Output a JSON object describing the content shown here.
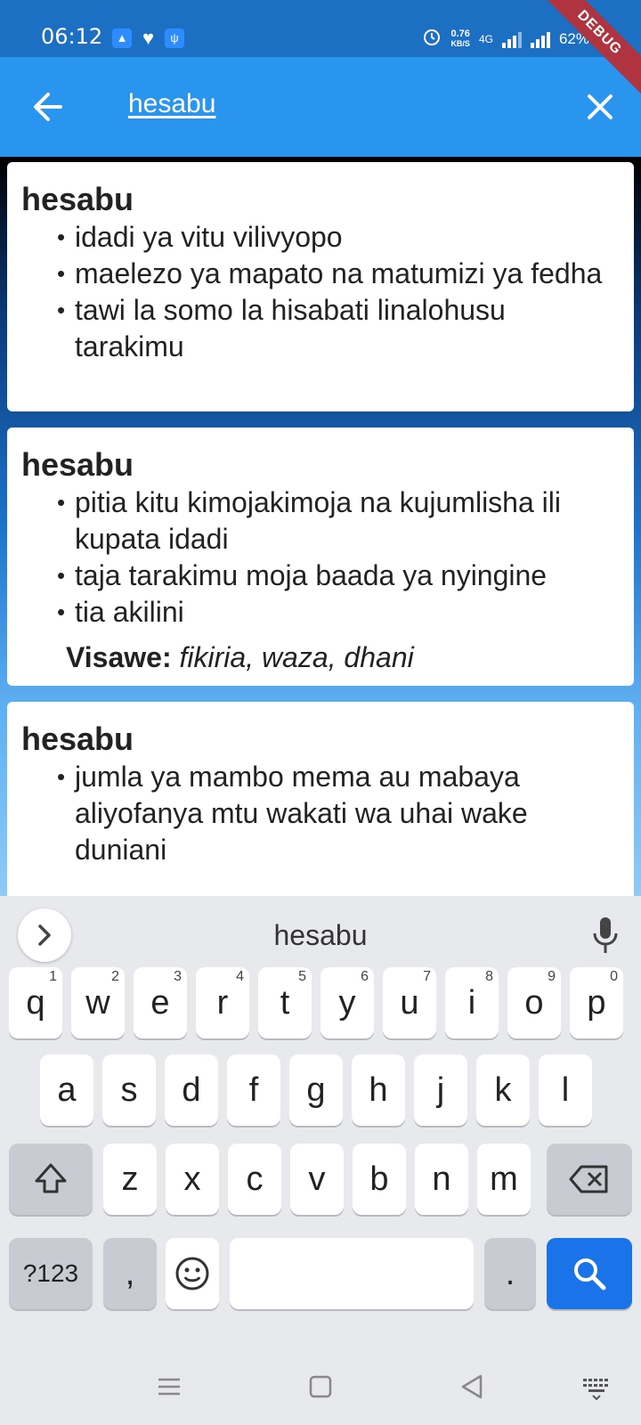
{
  "status_bar": {
    "time": "06:12",
    "net_speed_value": "0.76",
    "net_speed_unit": "KB/S",
    "network": "4G",
    "battery": "62%",
    "debug_label": "DEBUG"
  },
  "app_bar": {
    "search_query": "hesabu",
    "back_icon": "arrow-left-icon",
    "close_icon": "close-icon"
  },
  "results": [
    {
      "word": "hesabu",
      "definitions": [
        "idadi ya vitu vilivyopo",
        "maelezo ya mapato na matumizi ya fedha",
        " tawi la somo la hisabati linalohusu tarakimu"
      ]
    },
    {
      "word": "hesabu",
      "definitions": [
        "pitia kitu kimojakimoja na kujumlisha ili kupata idadi",
        "taja tarakimu moja baada ya nyingine",
        "tia akilini"
      ],
      "synonyms_label": "Visawe:",
      "synonyms": "fikiria, waza, dhani"
    },
    {
      "word": "hesabu",
      "definitions": [
        "jumla ya mambo mema au mabaya aliyofanya mtu wakati wa uhai wake duniani"
      ]
    }
  ],
  "keyboard": {
    "suggestion": "hesabu",
    "row1": [
      {
        "k": "q",
        "h": "1"
      },
      {
        "k": "w",
        "h": "2"
      },
      {
        "k": "e",
        "h": "3"
      },
      {
        "k": "r",
        "h": "4"
      },
      {
        "k": "t",
        "h": "5"
      },
      {
        "k": "y",
        "h": "6"
      },
      {
        "k": "u",
        "h": "7"
      },
      {
        "k": "i",
        "h": "8"
      },
      {
        "k": "o",
        "h": "9"
      },
      {
        "k": "p",
        "h": "0"
      }
    ],
    "row2": [
      "a",
      "s",
      "d",
      "f",
      "g",
      "h",
      "j",
      "k",
      "l"
    ],
    "row3": [
      "z",
      "x",
      "c",
      "v",
      "b",
      "n",
      "m"
    ],
    "symbols_key": "?123",
    "comma_key": ",",
    "period_key": "."
  },
  "colors": {
    "status_bar": "#1c6fc2",
    "app_bar": "#2a95ef",
    "search_key": "#1a73e8"
  }
}
